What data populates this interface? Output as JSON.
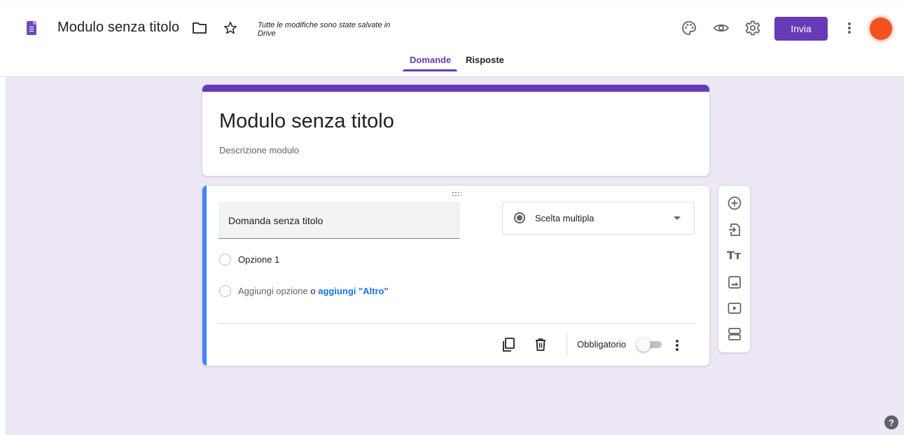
{
  "header": {
    "doc_title": "Modulo senza titolo",
    "save_status": "Tutte le modifiche sono state salvate in Drive",
    "send_label": "Invia",
    "icons": [
      "forms-logo",
      "folder-icon",
      "star-icon",
      "palette-icon",
      "preview-icon",
      "settings-icon",
      "more-vert-icon",
      "avatar"
    ]
  },
  "tabs": {
    "questions": "Domande",
    "responses": "Risposte",
    "active": "Domande"
  },
  "form": {
    "title": "Modulo senza titolo",
    "description_placeholder": "Descrizione modulo"
  },
  "question": {
    "title": "Domanda senza titolo",
    "type": "Scelta multipla",
    "options": [
      "Opzione 1"
    ],
    "add_option": "Aggiungi opzione",
    "or": "o",
    "add_other": "aggiungi \"Altro\"",
    "required_label": "Obbligatorio",
    "required": false
  },
  "toolbar": {
    "text_icon_glyph": "Tт",
    "items": [
      "add-question-icon",
      "import-questions-icon",
      "add-title-icon",
      "add-image-icon",
      "add-video-icon",
      "add-section-icon"
    ]
  },
  "help": {
    "glyph": "?"
  },
  "colors": {
    "accent": "#673ab7",
    "background": "#ede7f6",
    "question_accent": "#4285f4",
    "link": "#1a73e8",
    "avatar": "#f4511e"
  }
}
